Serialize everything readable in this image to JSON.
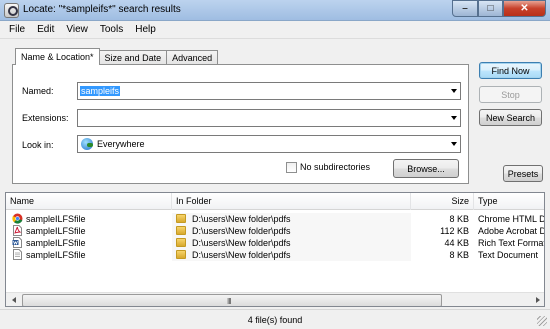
{
  "window": {
    "title": "Locate: \"*sampleifs*\" search results"
  },
  "menu": [
    "File",
    "Edit",
    "View",
    "Tools",
    "Help"
  ],
  "tabs": [
    "Name & Location*",
    "Size and Date",
    "Advanced"
  ],
  "form": {
    "named_label": "Named:",
    "named_value": "sampleifs",
    "extensions_label": "Extensions:",
    "extensions_value": "",
    "lookin_label": "Look in:",
    "lookin_value": "Everywhere",
    "no_subdirs_label": "No subdirectories",
    "no_subdirs_checked": false,
    "browse_label": "Browse..."
  },
  "buttons": {
    "find_now": "Find Now",
    "stop": "Stop",
    "new_search": "New Search",
    "presets": "Presets"
  },
  "results": {
    "columns": [
      "Name",
      "In Folder",
      "Size",
      "Type"
    ],
    "rows": [
      {
        "name": "sampleILFSfile",
        "folder": "D:\\users\\New folder\\pdfs",
        "size": "8 KB",
        "type": "Chrome HTML Do",
        "icon": "chrome-html-icon"
      },
      {
        "name": "sampleILFSfile",
        "folder": "D:\\users\\New folder\\pdfs",
        "size": "112 KB",
        "type": "Adobe Acrobat D",
        "icon": "pdf-icon"
      },
      {
        "name": "sampleILFSfile",
        "folder": "D:\\users\\New folder\\pdfs",
        "size": "44 KB",
        "type": "Rich Text Format",
        "icon": "rtf-icon"
      },
      {
        "name": "sampleILFSfile",
        "folder": "D:\\users\\New folder\\pdfs",
        "size": "8 KB",
        "type": "Text Document",
        "icon": "text-doc-icon"
      }
    ],
    "scroll_grip": "III"
  },
  "status": {
    "text": "4 file(s) found"
  }
}
